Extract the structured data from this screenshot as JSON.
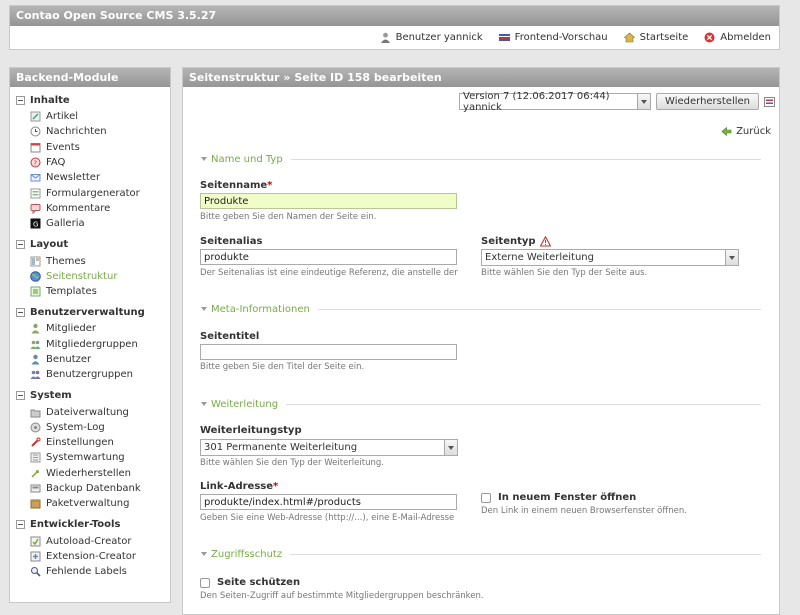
{
  "app": {
    "title": "Contao Open Source CMS 3.5.27",
    "toolbar": [
      {
        "icon": "user-icon",
        "label": "Benutzer yannick"
      },
      {
        "icon": "preview-flag-icon",
        "label": "Frontend-Vorschau"
      },
      {
        "icon": "home-icon",
        "label": "Startseite"
      },
      {
        "icon": "logout-icon",
        "label": "Abmelden"
      }
    ]
  },
  "sidebar": {
    "title": "Backend-Module",
    "groups": [
      {
        "label": "Inhalte",
        "items": [
          {
            "label": "Artikel",
            "icon": "article-icon"
          },
          {
            "label": "Nachrichten",
            "icon": "news-icon"
          },
          {
            "label": "Events",
            "icon": "calendar-icon"
          },
          {
            "label": "FAQ",
            "icon": "faq-icon"
          },
          {
            "label": "Newsletter",
            "icon": "newsletter-icon"
          },
          {
            "label": "Formulargenerator",
            "icon": "form-icon"
          },
          {
            "label": "Kommentare",
            "icon": "comments-icon"
          },
          {
            "label": "Galleria",
            "icon": "galleria-icon"
          }
        ]
      },
      {
        "label": "Layout",
        "items": [
          {
            "label": "Themes",
            "icon": "themes-icon"
          },
          {
            "label": "Seitenstruktur",
            "icon": "globe-icon",
            "active": true
          },
          {
            "label": "Templates",
            "icon": "templates-icon"
          }
        ]
      },
      {
        "label": "Benutzerverwaltung",
        "items": [
          {
            "label": "Mitglieder",
            "icon": "member-icon"
          },
          {
            "label": "Mitgliedergruppen",
            "icon": "member-group-icon"
          },
          {
            "label": "Benutzer",
            "icon": "user-icon"
          },
          {
            "label": "Benutzergruppen",
            "icon": "user-group-icon"
          }
        ]
      },
      {
        "label": "System",
        "items": [
          {
            "label": "Dateiverwaltung",
            "icon": "files-icon"
          },
          {
            "label": "System-Log",
            "icon": "log-icon"
          },
          {
            "label": "Einstellungen",
            "icon": "settings-icon"
          },
          {
            "label": "Systemwartung",
            "icon": "maintenance-icon"
          },
          {
            "label": "Wiederherstellen",
            "icon": "restore-icon"
          },
          {
            "label": "Backup Datenbank",
            "icon": "backup-icon"
          },
          {
            "label": "Paketverwaltung",
            "icon": "package-icon"
          }
        ]
      },
      {
        "label": "Entwickler-Tools",
        "items": [
          {
            "label": "Autoload-Creator",
            "icon": "autoload-icon"
          },
          {
            "label": "Extension-Creator",
            "icon": "extension-icon"
          },
          {
            "label": "Fehlende Labels",
            "icon": "magnifier-icon"
          }
        ]
      }
    ]
  },
  "main": {
    "title": "Seitenstruktur » Seite ID 158 bearbeiten",
    "version_select": "Version 7 (12.06.2017 06:44) yannick",
    "restore_button": "Wiederherstellen",
    "back_label": "Zurück",
    "sections": {
      "name": "Name und Typ",
      "meta": "Meta-Informationen",
      "redirect": "Weiterleitung",
      "protect": "Zugriffsschutz"
    },
    "fields": {
      "seitenname": {
        "label": "Seitenname",
        "required": "*",
        "value": "Produkte",
        "help": "Bitte geben Sie den Namen der Seite ein."
      },
      "seitenalias": {
        "label": "Seitenalias",
        "value": "produkte",
        "help": "Der Seitenalias ist eine eindeutige Referenz, die anstelle der"
      },
      "seitentyp": {
        "label": "Seitentyp",
        "value": "Externe Weiterleitung",
        "help": "Bitte wählen Sie den Typ der Seite aus."
      },
      "seitentitel": {
        "label": "Seitentitel",
        "value": "",
        "help": "Bitte geben Sie den Titel der Seite ein."
      },
      "weiterleitungstyp": {
        "label": "Weiterleitungstyp",
        "value": "301 Permanente Weiterleitung",
        "help": "Bitte wählen Sie den Typ der Weiterleitung."
      },
      "linkadresse": {
        "label": "Link-Adresse",
        "required": "*",
        "value": "produkte/index.html#/products",
        "help": "Geben Sie eine Web-Adresse (http://...), eine E-Mail-Adresse"
      },
      "neuesfenster": {
        "label": "In neuem Fenster öffnen",
        "help": "Den Link in einem neuen Browserfenster öffnen."
      },
      "schuetzen": {
        "label": "Seite schützen",
        "help": "Den Seiten-Zugriff auf bestimmte Mitgliedergruppen beschränken."
      }
    }
  },
  "colors": {
    "accent": "#77ac45",
    "required": "#cc0000",
    "header": "#a5a5a5"
  }
}
